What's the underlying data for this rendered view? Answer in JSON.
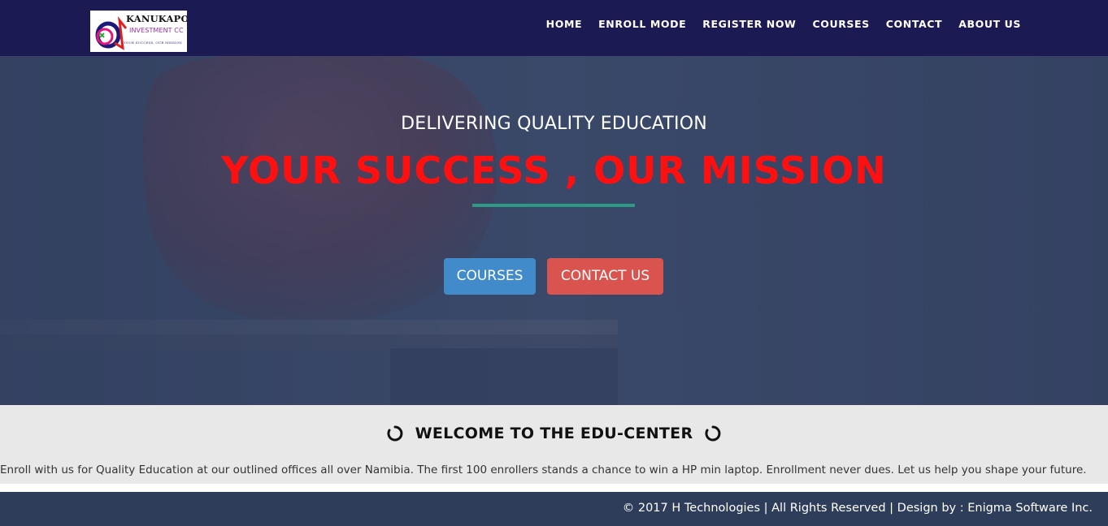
{
  "brand": {
    "name": "KANUKAPO",
    "subtitle": "INVESTMENT CC",
    "tagline": "YOUR SUCCESS, OUR MISSION",
    "logo_icon": "kanukapo-logo"
  },
  "nav": {
    "items": [
      {
        "label": "HOME"
      },
      {
        "label": "ENROLL MODE"
      },
      {
        "label": "REGISTER NOW"
      },
      {
        "label": "COURSES"
      },
      {
        "label": "CONTACT"
      },
      {
        "label": "ABOUT US"
      }
    ]
  },
  "hero": {
    "subtitle": "DELIVERING QUALITY EDUCATION",
    "title": "YOUR SUCCESS , OUR MISSION",
    "background_icon": "apple-on-books-photo",
    "buttons": {
      "courses": "COURSES",
      "contact": "CONTACT US"
    }
  },
  "welcome": {
    "title": "WELCOME TO THE EDU-CENTER",
    "icon": "spinner-icon",
    "text": "Enroll with us for Quality Education at our outlined offices all over Namibia. The first 100 enrollers stands a chance to win a HP min laptop. Enrollment never dues. Let us help you shape your future."
  },
  "footer": {
    "text": "© 2017 H Technologies | All Rights Reserved | Design by : Enigma Software Inc."
  },
  "colors": {
    "navbar": "#1b1a52",
    "hero_overlay": "#374668",
    "title_red": "#ff1010",
    "rule_teal": "#2b9b86",
    "btn_blue": "#428bca",
    "btn_red": "#d9534f",
    "welcome_bg": "#e8e8e8",
    "footer_bg": "#2e3d5a"
  }
}
